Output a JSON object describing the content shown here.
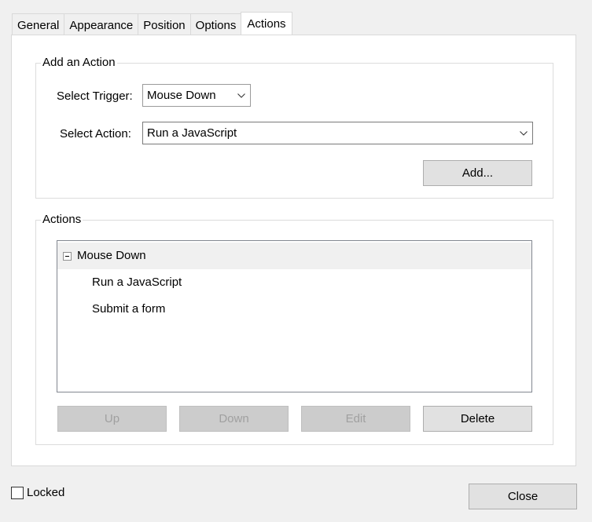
{
  "tabs": [
    "General",
    "Appearance",
    "Position",
    "Options",
    "Actions"
  ],
  "active_tab": "Actions",
  "add_action": {
    "title": "Add an Action",
    "trigger_label": "Select Trigger:",
    "trigger_value": "Mouse Down",
    "action_label": "Select Action:",
    "action_value": "Run a JavaScript",
    "add_button": "Add..."
  },
  "actions": {
    "title": "Actions",
    "tree": {
      "trigger": "Mouse Down",
      "items": [
        "Run a JavaScript",
        "Submit a form"
      ]
    },
    "buttons": {
      "up": "Up",
      "down": "Down",
      "edit": "Edit",
      "delete": "Delete"
    }
  },
  "footer": {
    "locked_label": "Locked",
    "locked_checked": false,
    "close_button": "Close"
  },
  "icons": {
    "dropdown": "chevron-down-icon",
    "collapse": "collapse-minus-icon"
  }
}
